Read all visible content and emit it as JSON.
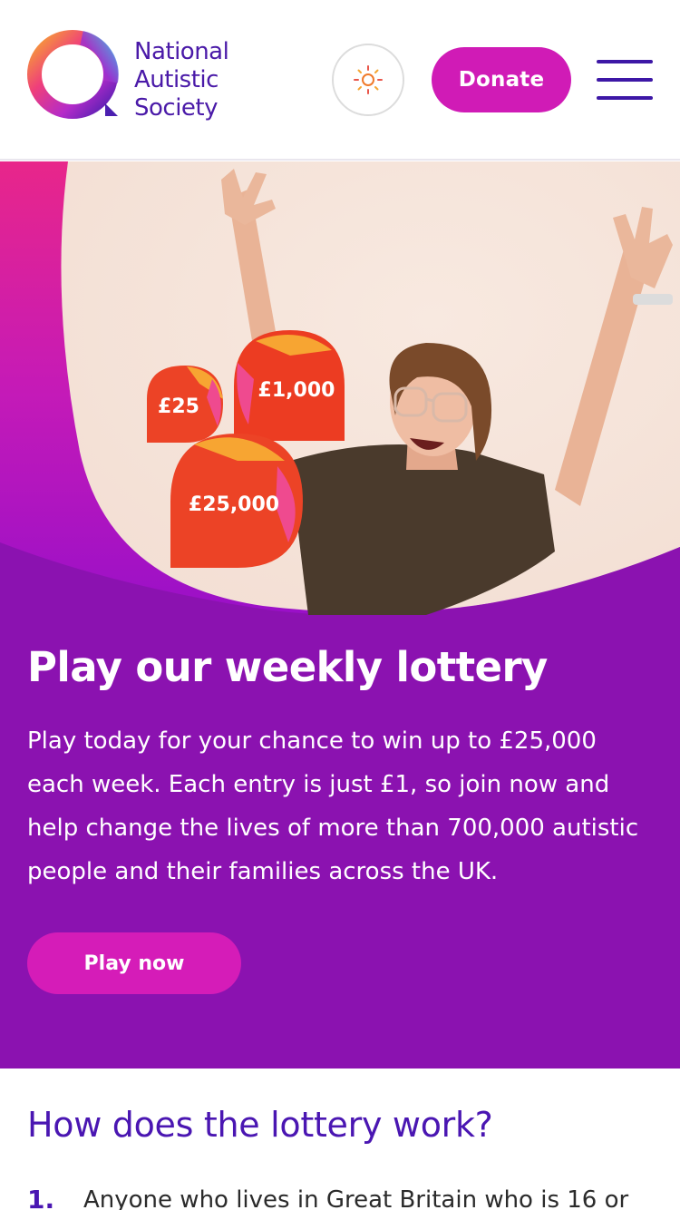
{
  "header": {
    "logo_lines": [
      "National",
      "Autistic",
      "Society"
    ],
    "theme_icon": "sun-icon",
    "donate_label": "Donate",
    "menu_icon": "hamburger-menu-icon"
  },
  "hero": {
    "prizes": [
      "£25",
      "£1,000",
      "£25,000"
    ],
    "title": "Play our weekly lottery",
    "body": "Play today for your chance to win up to £25,000 each week. Each entry is just £1, so join now and help change the lives of more than 700,000 autistic people and their families across the UK.",
    "cta_label": "Play now"
  },
  "section": {
    "title": "How does the lottery work?",
    "items": [
      {
        "number": "1.",
        "text": "Anyone who lives in Great Britain who is 16 or"
      }
    ]
  },
  "colors": {
    "brand_purple": "#8b12b0",
    "brand_magenta": "#d01bb6",
    "heading_indigo": "#4a16b2",
    "hero_cream": "#f6e3d8",
    "prize_orange": "#ee3e25"
  }
}
